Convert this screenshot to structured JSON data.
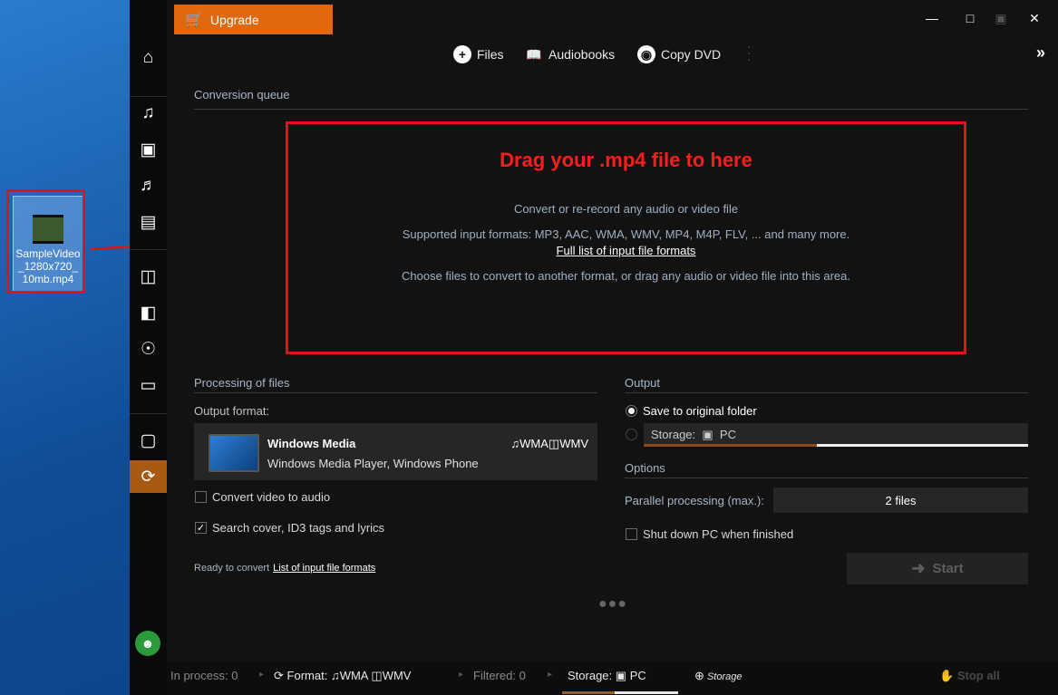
{
  "desktop": {
    "file_icon_label": "SampleVideo_1280x720_10mb.mp4"
  },
  "titlebar": {
    "upgrade_label": "Upgrade",
    "minimize": "—",
    "maximize": "□",
    "compact": "▣",
    "close": "✕",
    "expand": "»"
  },
  "topnav": {
    "files": "Files",
    "audiobooks": "Audiobooks",
    "copy_dvd": "Copy DVD"
  },
  "queue": {
    "title": "Conversion queue",
    "drop_title": "Drag your .mp4 file to here",
    "line1": "Convert or re-record any audio or video file",
    "line2": "Supported input formats: MP3, AAC, WMA, WMV, MP4, M4P, FLV, ... and many more.",
    "link": "Full list of input file formats",
    "line3": "Choose files to convert to another format, or drag any audio or video file into this area."
  },
  "processing": {
    "title": "Processing of files",
    "output_format_label": "Output format:",
    "format_name": "Windows Media",
    "format_desc": "Windows Media Player, Windows Phone",
    "format_audio": "WMA",
    "format_video": "WMV",
    "convert_video_label": "Convert video to audio",
    "convert_video_checked": false,
    "search_cover_label": "Search cover, ID3 tags and lyrics",
    "search_cover_checked": true,
    "ready_text": "Ready to convert",
    "ready_link": "List of input file formats"
  },
  "output": {
    "title": "Output",
    "save_original": "Save to original folder",
    "storage_label": "Storage:",
    "storage_value": "PC",
    "storage_fill": 0.45
  },
  "options": {
    "title": "Options",
    "parallel_label": "Parallel processing (max.):",
    "parallel_value": "2 files",
    "shutdown_label": "Shut down PC when finished",
    "start_label": "Start"
  },
  "statusbar": {
    "in_process": "In process: 0",
    "format_label": "Format:",
    "format_audio": "WMA",
    "format_video": "WMV",
    "filtered": "Filtered: 0",
    "storage_label": "Storage:",
    "storage_value": "PC",
    "add_storage": "Storage",
    "stop_all": "Stop all"
  },
  "colors": {
    "accent": "#e0680f",
    "highlight_red": "#e0121a"
  }
}
